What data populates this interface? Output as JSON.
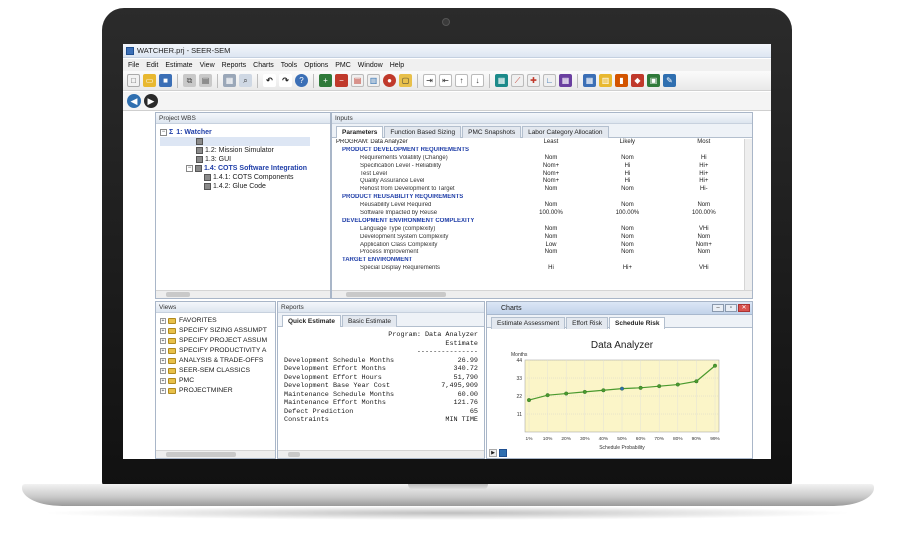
{
  "window": {
    "title": "WATCHER.prj - SEER-SEM"
  },
  "menu": [
    "File",
    "Edit",
    "Estimate",
    "View",
    "Reports",
    "Charts",
    "Tools",
    "Options",
    "PMC",
    "Window",
    "Help"
  ],
  "colors": {
    "accent": "#1f3ea8",
    "titlebar": "#dde6f2",
    "chart_bg": "#fbf5c8",
    "line": "#4a9a2e",
    "marker": "#2f6fb0"
  },
  "wbs": {
    "title": "Project WBS",
    "items": [
      {
        "label": "1: Watcher",
        "prefix": "Σ"
      },
      {
        "label": ""
      },
      {
        "label": "1.2: Mission Simulator"
      },
      {
        "label": "1.3: GUI"
      },
      {
        "label": "1.4: COTS Software Integration"
      },
      {
        "label": "1.4.1: COTS Components"
      },
      {
        "label": "1.4.2: Glue Code"
      }
    ]
  },
  "inputs": {
    "title": "Inputs",
    "tabs": [
      "Parameters",
      "Function Based Sizing",
      "PMC Snapshots",
      "Labor Category Allocation"
    ],
    "program_label": "PROGRAM: Data Analyzer",
    "columns": [
      "Least",
      "Likely",
      "Most"
    ],
    "rows": [
      {
        "name": "PRODUCT DEVELOPMENT REQUIREMENTS",
        "group": true
      },
      {
        "name": "Requirements Volatility (Change)",
        "least": "Nom",
        "likely": "Nom",
        "most": "Hi"
      },
      {
        "name": "Specification Level - Reliability",
        "least": "Nom+",
        "likely": "Hi",
        "most": "Hi+"
      },
      {
        "name": "Test Level",
        "least": "Nom+",
        "likely": "Hi",
        "most": "Hi+"
      },
      {
        "name": "Quality Assurance Level",
        "least": "Nom+",
        "likely": "Hi",
        "most": "Hi+"
      },
      {
        "name": "Rehost from Development to Target",
        "least": "Nom",
        "likely": "Nom",
        "most": "Hi-"
      },
      {
        "name": "PRODUCT REUSABILITY REQUIREMENTS",
        "group": true
      },
      {
        "name": "Reusability Level Required",
        "least": "Nom",
        "likely": "Nom",
        "most": "Nom"
      },
      {
        "name": "Software Impacted by Reuse",
        "least": "100.00%",
        "likely": "100.00%",
        "most": "100.00%"
      },
      {
        "name": "DEVELOPMENT ENVIRONMENT COMPLEXITY",
        "group": true
      },
      {
        "name": "Language Type (complexity)",
        "least": "Nom",
        "likely": "Nom",
        "most": "VHi"
      },
      {
        "name": "Development System Complexity",
        "least": "Nom",
        "likely": "Nom",
        "most": "Nom"
      },
      {
        "name": "Application Class Complexity",
        "least": "Low",
        "likely": "Nom",
        "most": "Nom+"
      },
      {
        "name": "Process Improvement",
        "least": "Nom",
        "likely": "Nom",
        "most": "Nom"
      },
      {
        "name": "TARGET ENVIRONMENT",
        "group": true
      },
      {
        "name": "Special Display Requirements",
        "least": "Hi",
        "likely": "Hi+",
        "most": "VHi"
      }
    ]
  },
  "views": {
    "title": "Views",
    "items": [
      "FAVORITES",
      "SPECIFY SIZING ASSUMPT",
      "SPECIFY PROJECT ASSUM",
      "SPECIFY PRODUCTIVITY A",
      "ANALYSIS & TRADE-OFFS",
      "SEER-SEM CLASSICS",
      "PMC",
      "PROJECTMINER"
    ]
  },
  "reports": {
    "title": "Reports",
    "tabs": [
      "Quick Estimate",
      "Basic Estimate"
    ],
    "header_program": "Program: Data Analyzer",
    "header_sub": "Estimate",
    "header_rule": "---------------",
    "lines": [
      {
        "label": "Development Schedule Months",
        "value": "26.99"
      },
      {
        "label": "Development Effort Months",
        "value": "340.72"
      },
      {
        "label": "Development Effort Hours",
        "value": "51,790"
      },
      {
        "label": "Development Base Year Cost",
        "value": "7,495,909"
      },
      {
        "label": "Maintenance Schedule Months",
        "value": "60.00"
      },
      {
        "label": "Maintenance Effort Months",
        "value": "121.76"
      },
      {
        "label": "Defect Prediction",
        "value": "65"
      },
      {
        "label": "Constraints",
        "value": "MIN TIME"
      }
    ]
  },
  "charts": {
    "title": "Charts",
    "tabs": [
      "Estimate Assessment",
      "Effort Risk",
      "Schedule Risk"
    ]
  },
  "chart_data": {
    "type": "line",
    "title": "Data Analyzer",
    "ylabel": "Months",
    "xlabel": "Schedule Probability",
    "x": [
      "1%",
      "10%",
      "20%",
      "30%",
      "40%",
      "50%",
      "60%",
      "70%",
      "80%",
      "90%",
      "99%"
    ],
    "yticks": [
      11,
      22,
      33,
      44
    ],
    "ylim": [
      0,
      44
    ],
    "series": [
      {
        "values": [
          19.5,
          22.5,
          23.5,
          24.5,
          25.5,
          26.5,
          27,
          28,
          29,
          31,
          40.5
        ]
      }
    ],
    "grid": true
  }
}
